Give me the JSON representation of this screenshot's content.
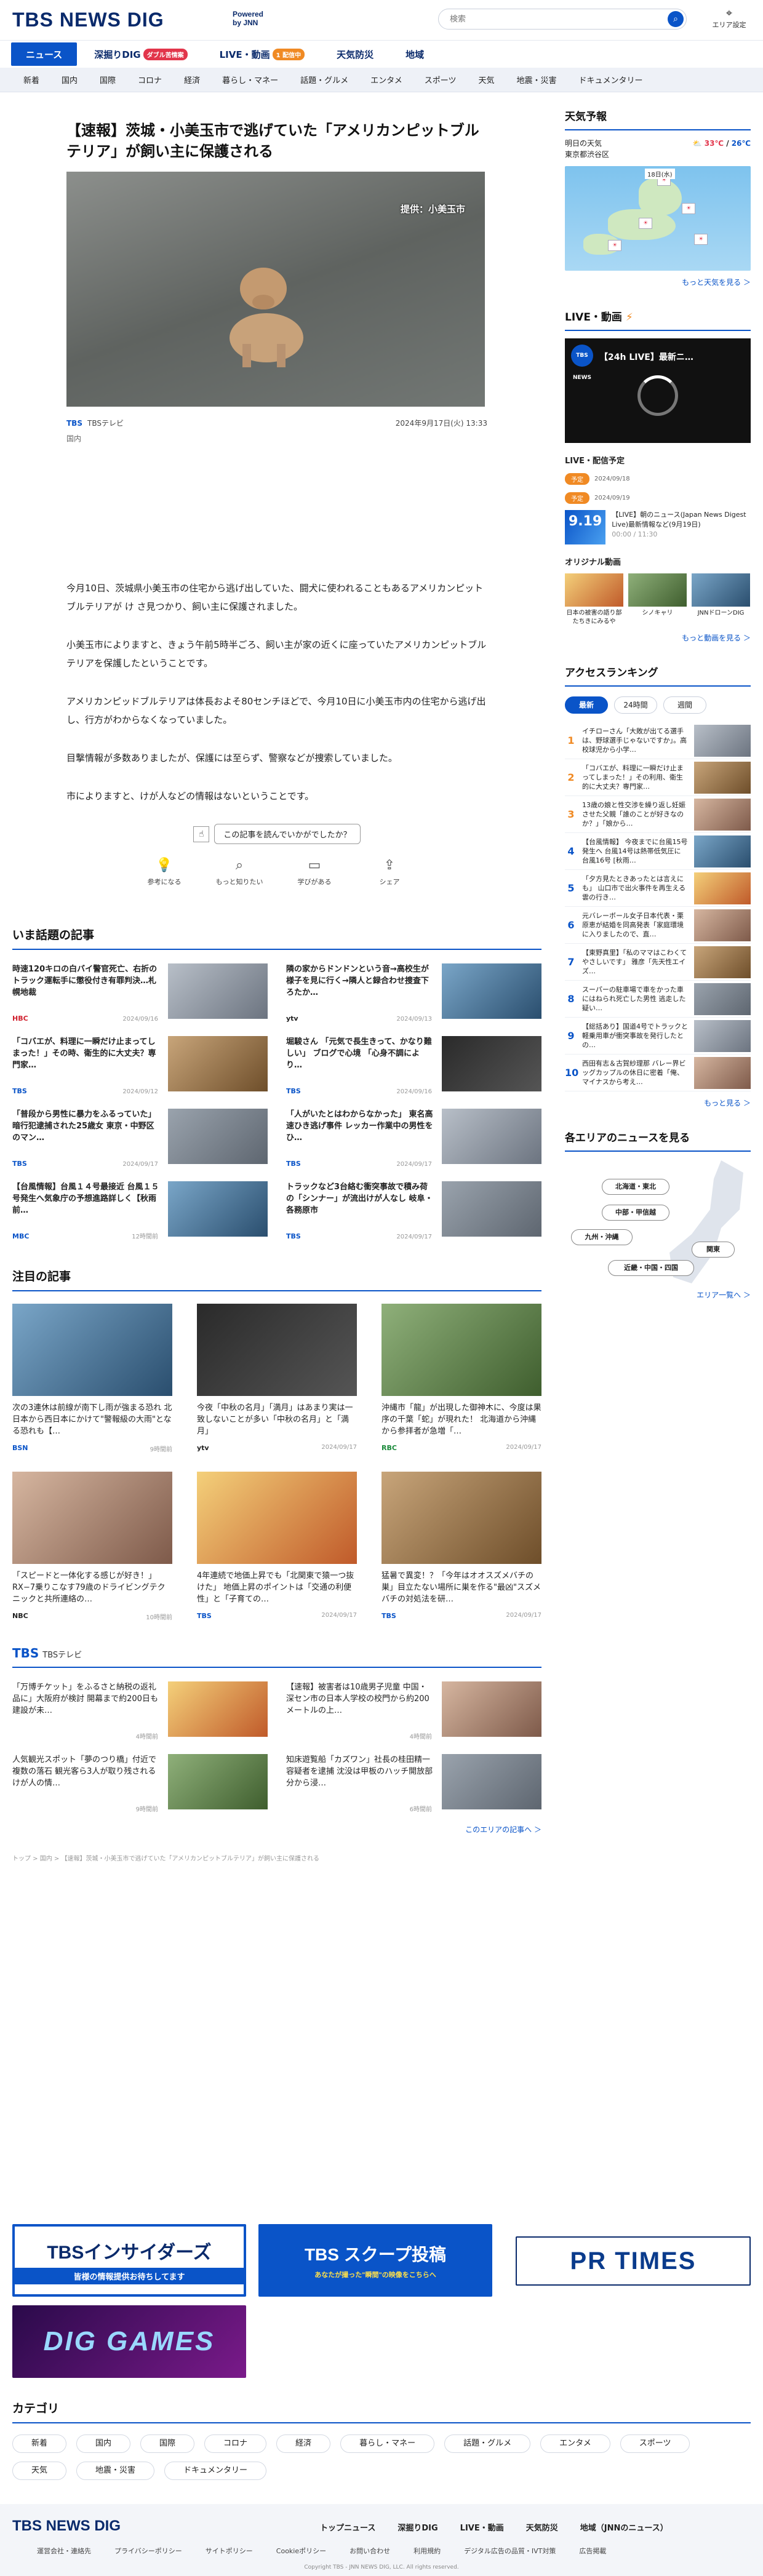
{
  "header": {
    "logo": "TBS NEWS DIG",
    "powered": "Powered by JNN",
    "search_placeholder": "検索",
    "area_label": "エリア設定"
  },
  "nav1": [
    {
      "label": "ニュース",
      "on": true
    },
    {
      "label": "深掘りDIG",
      "badge": "ダブル苦情案"
    },
    {
      "label": "LIVE・動画",
      "badge": "1 配信中"
    },
    {
      "label": "天気防災"
    },
    {
      "label": "地域"
    }
  ],
  "nav2": [
    "新着",
    "国内",
    "国際",
    "コロナ",
    "経済",
    "暮らし・マネー",
    "話題・グルメ",
    "エンタメ",
    "スポーツ",
    "天気",
    "地震・災害",
    "ドキュメンタリー"
  ],
  "article": {
    "title": "【速報】茨城・小美玉市で逃げていた「アメリカンピットブルテリア」が飼い主に保護される",
    "image_credit": "提供：小美玉市",
    "source": "TBS",
    "source_sub": "TBSテレビ",
    "date": "2024年9月17日(火) 13:33",
    "category": "国内",
    "paragraphs": [
      "今月10日、茨城県小美玉市の住宅から逃げ出していた、闘犬に使われることもあるアメリカンピットブルテリアが け さ見つかり、飼い主に保護されました。",
      "小美玉市によりますと、きょう午前5時半ごろ、飼い主が家の近くに座っていたアメリカンピットブルテリアを保護したということです。",
      "アメリカンピッドブルテリアは体長およそ80センチほどで、今月10日に小美玉市内の住宅から逃げ出し、行方がわからなくなっていました。",
      "目撃情報が多数ありましたが、保護には至らず、警察などが捜索していました。",
      "市によりますと、けが人などの情報はないということです。"
    ],
    "question": "この記事を読んでいかがでしたか？",
    "reactions": [
      "参考になる",
      "もっと知りたい",
      "学びがある",
      "シェア"
    ]
  },
  "trending": {
    "title": "いま話題の記事",
    "items": [
      {
        "text": "時速120キロの白バイ警官死亡、右折のトラック運転手に懲役付き有罪判決…札幌地裁",
        "src": "HBC",
        "date": "2024/09/16"
      },
      {
        "text": "隣の家からドンドンという音→高校生が様子を見に行く→隣人と録合わせ捜査下ろたか…",
        "src": "ytv",
        "date": "2024/09/13"
      },
      {
        "text": "「コバエが、料理に一瞬だけ止まってしまった！」その時、衛生的に大丈夫？専門家…",
        "src": "TBS",
        "date": "2024/09/12"
      },
      {
        "text": "堀駿さん 「元気で長生きって、かなり難しい」 ブログで心境 「心身不調によ り…",
        "src": "TBS",
        "date": "2024/09/16"
      },
      {
        "text": "「普段から男性に暴力をふるっていた」暗行犯逮捕された25歳女 東京・中野区のマン…",
        "src": "TBS",
        "date": "2024/09/17"
      },
      {
        "text": "「人がいたとはわからなかった」 東名高速ひき逃げ事件 レッカー作業中の男性をひ…",
        "src": "TBS",
        "date": "2024/09/17"
      },
      {
        "text": "【台風情報】台風１４号最接近 台風１５号発生へ気象庁の予想進路詳しく【秋雨前…",
        "src": "MBC",
        "date": "12時間前"
      },
      {
        "text": "トラックなど3台絡む衝突事故で積み荷の「シンナー」が流出けが人なし 岐阜・各務原市",
        "src": "TBS",
        "date": "2024/09/17"
      }
    ]
  },
  "featured": {
    "title": "注目の記事",
    "items": [
      {
        "text": "次の3連休は前線が南下し雨が強まる恐れ 北日本から西日本にかけて\"警報級の大雨\"となる恐れも【…",
        "src": "BSN",
        "date": "9時間前"
      },
      {
        "text": "今夜「中秋の名月」「満月」はあまり実は一致しないことが多い「中秋の名月」と「満月」",
        "src": "ytv",
        "date": "2024/09/17"
      },
      {
        "text": "沖縄市「龍」が出現した御神木に、今度は果序の千葉「蛇」が現れた！ 北海道から沖縄から参拝者が急増「…",
        "src": "RBC",
        "date": "2024/09/17"
      },
      {
        "text": "「スピードと一体化する感じが好き！」RX−7乗りこなす79歳のドライビングテクニックと共所連絡の…",
        "src": "NBC",
        "date": "10時間前"
      },
      {
        "text": "4年連続で地価上昇でも「北関東で猿一つ抜けた」 地価上昇のポイントは「交通の利便性」と「子育ての…",
        "src": "TBS",
        "date": "2024/09/17"
      },
      {
        "text": "猛暑で異変！？「今年はオオスズメバチの巣」目立たない場所に巣を作る\"最凶\"スズメバチの対処法を研…",
        "src": "TBS",
        "date": "2024/09/17"
      }
    ]
  },
  "area_news": {
    "title": "TBS",
    "sub": "TBSテレビ",
    "items": [
      {
        "text": "「万博チケット」をふるさと納税の返礼品に」大阪府が検討 開幕まで約200日も建設が未…",
        "date": "4時間前"
      },
      {
        "text": "【速報】被害者は10歳男子児童 中国・深セン市の日本人学校の校門から約200メートルの上…",
        "date": "4時間前"
      },
      {
        "text": "人気観光スポット「夢のつり橋」付近で複数の落石 観光客ら3人が取り残される けが人の情…",
        "date": "9時間前"
      },
      {
        "text": "知床遊覧船「カズワン」社長の桂田精一容疑者を逮捕 沈没は甲板のハッチ開放部分から浸…",
        "date": "6時間前"
      }
    ],
    "more": "このエリアの記事へ ＞"
  },
  "breadcrumb": "トップ > 国内 > 【速報】茨城・小美玉市で逃げていた「アメリカンピットブルテリア」が飼い主に保護される",
  "banners": [
    {
      "title": "TBSインサイダーズ",
      "sub": "皆様の情報提供お待ちしてます"
    },
    {
      "title": "TBS スクープ投稿",
      "sub": "あなたが撮った\"瞬間\"の映像をこちらへ"
    },
    {
      "title": "PR TIMES"
    },
    {
      "title": "DIG GAMES"
    }
  ],
  "categories": {
    "title": "カテゴリ",
    "items": [
      "新着",
      "国内",
      "国際",
      "コロナ",
      "経済",
      "暮らし・マネー",
      "話題・グルメ",
      "エンタメ",
      "スポーツ",
      "天気",
      "地震・災害",
      "ドキュメンタリー"
    ]
  },
  "sidebar": {
    "weather": {
      "title": "天気予報",
      "day": "明日の天気",
      "place": "東京都渋谷区",
      "hi": "33℃",
      "lo": "26℃",
      "more": "もっと天気を見る ＞",
      "map_date": "18日(水)"
    },
    "live": {
      "title": "LIVE・動画",
      "stream_title": "【24h LIVE】最新ニ…",
      "logo": "TBS NEWS",
      "schedule": "LIVE・配信予定",
      "rows": [
        {
          "pill": "予定",
          "date": "2024/09/18"
        },
        {
          "pill": "予定",
          "date": "2024/09/19"
        }
      ],
      "prog_date": "9.19",
      "prog_text": "【LIVE】朝のニュース(Japan News Digest Live)最新情報など(9月19日)",
      "prog_time": "00:00 / 11:30",
      "orig_title": "オリジナル動画",
      "origs": [
        "日本の被害の語り部たちきにみるや",
        "シノキャリ",
        "JNNドローンDIG"
      ],
      "more": "もっと動画を見る ＞"
    },
    "ranking": {
      "title": "アクセスランキング",
      "tabs": [
        "最新",
        "24時間",
        "週間"
      ],
      "items": [
        "イチローさん「大敗が出てる選手は、野球選手じゃないですか」。高校球児から小学…",
        "「コバエが、料理に一瞬だけ止まってしまった！」その利用、衛生的に大丈夫？専門家…",
        "13歳の娘と性交渉を繰り返し妊娠させた父親「誰のことが好きなのか？」「娘から…",
        "【台風情報】 今夜までに台風15号発生へ 台風14号は熱帯低気圧に 台風16号 [秋雨…",
        "「夕方見たときあったとは言えにも」 山口市で出火事件を再生える 雲の行き…",
        "元バレーボール女子日本代表・栗原恵が結婚を同高発表「家庭環境に入りましたので、直…",
        "【東野真里】「私のママはこわくてやさしいです」 雅彦「先天性エイズ…",
        "スーパーの駐車場で車をかった車にはねられ死亡した男性 逃走した疑い…",
        "【総括あり】国道4号でトラックと軽乗用車が衝突事故を発行したとの…",
        "西田有志＆古賀紗理那 バレー界ビッグカップルの休日に密着「俺、マイナスから考え…"
      ],
      "more": "もっと見る ＞"
    },
    "areas": {
      "title": "各エリアのニュースを見る",
      "regions": [
        "北海道・東北",
        "中部・甲信越",
        "九州・沖縄",
        "関東",
        "近畿・中国・四国"
      ],
      "more": "エリア一覧へ ＞"
    }
  },
  "footer": {
    "logo": "TBS NEWS DIG",
    "links": [
      "トップニュース",
      "深掘りDIG",
      "LIVE・動画",
      "天気防災",
      "地域（JNNのニュース）"
    ],
    "links2": [
      "運営会社・連絡先",
      "プライバシーポリシー",
      "サイトポリシー",
      "Cookieポリシー",
      "お問い合わせ",
      "利用規約",
      "デジタル広告の品質・IVT対策",
      "広告掲載"
    ],
    "copyright": "Copyright TBS - JNN NEWS DIG, LLC. All rights reserved."
  }
}
